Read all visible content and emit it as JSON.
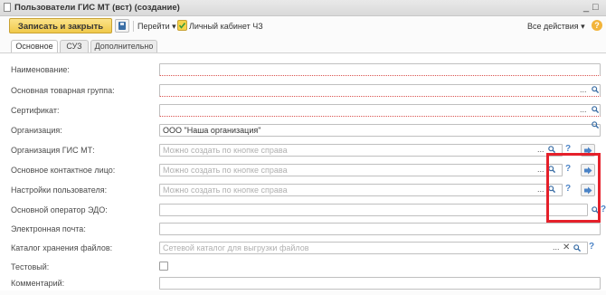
{
  "window": {
    "title": "Пользователи ГИС МТ (вст) (создание)",
    "minimize": "_",
    "maximize": "□"
  },
  "toolbar": {
    "save_close": "Записать и закрыть",
    "goto": "Перейти ▾",
    "personal_cabinet": "Личный кабинет ЧЗ",
    "all_actions": "Все действия ▾",
    "help": "?"
  },
  "tabs": [
    {
      "label": "Основное",
      "active": true
    },
    {
      "label": "СУЗ",
      "active": false
    },
    {
      "label": "Дополнительно",
      "active": false
    }
  ],
  "form": {
    "fields": [
      {
        "label": "Наименование:",
        "value": "",
        "placeholder": ""
      },
      {
        "label": "Основная товарная группа:",
        "value": "",
        "placeholder": ""
      },
      {
        "label": "Сертификат:",
        "value": "",
        "placeholder": ""
      },
      {
        "label": "Организация:",
        "value": "ООО \"Наша организация\"",
        "placeholder": ""
      },
      {
        "label": "Организация ГИС МТ:",
        "value": "",
        "placeholder": "Можно создать по кнопке справа"
      },
      {
        "label": "Основное контактное лицо:",
        "value": "",
        "placeholder": "Можно создать по кнопке справа"
      },
      {
        "label": "Настройки пользователя:",
        "value": "",
        "placeholder": "Можно создать по кнопке справа"
      },
      {
        "label": "Основной оператор ЭДО:",
        "value": "",
        "placeholder": ""
      },
      {
        "label": "Электронная почта:",
        "value": "",
        "placeholder": ""
      },
      {
        "label": "Каталог хранения файлов:",
        "value": "",
        "placeholder": "Сетевой каталог для выгрузки файлов"
      },
      {
        "label": "Тестовый:",
        "checked": false
      },
      {
        "label": "Комментарий:",
        "value": "",
        "placeholder": ""
      }
    ],
    "choice_label": "...",
    "help_mark": "?",
    "clear_mark": "✕"
  },
  "colors": {
    "primary_button": "#f0c94a",
    "highlight_box": "#e5202a",
    "help_icon": "#f2b43a",
    "link_blue": "#4b83c6"
  }
}
